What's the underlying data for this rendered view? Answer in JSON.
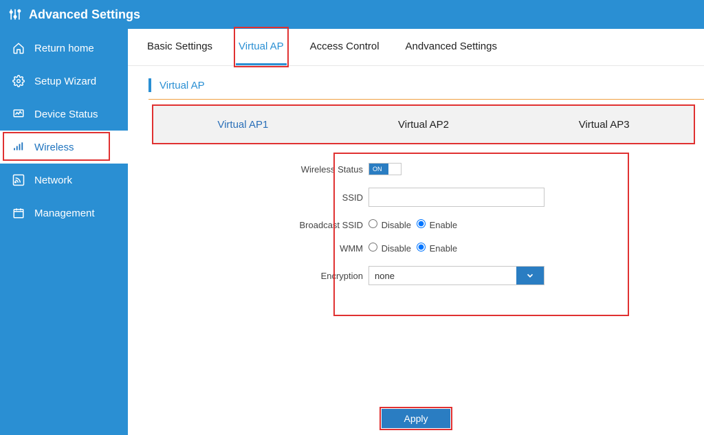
{
  "header": {
    "title": "Advanced Settings"
  },
  "sidebar": {
    "items": [
      {
        "label": "Return home"
      },
      {
        "label": "Setup Wizard"
      },
      {
        "label": "Device Status"
      },
      {
        "label": "Wireless"
      },
      {
        "label": "Network"
      },
      {
        "label": "Management"
      }
    ]
  },
  "tabs": [
    {
      "label": "Basic Settings"
    },
    {
      "label": "Virtual AP"
    },
    {
      "label": "Access Control"
    },
    {
      "label": "Andvanced Settings"
    }
  ],
  "section": {
    "title": "Virtual AP"
  },
  "subtabs": [
    {
      "label": "Virtual AP1"
    },
    {
      "label": "Virtual AP2"
    },
    {
      "label": "Virtual AP3"
    }
  ],
  "form": {
    "wireless_status": {
      "label": "Wireless Status",
      "toggle_text": "ON",
      "value": "on"
    },
    "ssid": {
      "label": "SSID",
      "value": ""
    },
    "broadcast": {
      "label": "Broadcast SSID",
      "option_disable": "Disable",
      "option_enable": "Enable",
      "value": "Enable"
    },
    "wmm": {
      "label": "WMM",
      "option_disable": "Disable",
      "option_enable": "Enable",
      "value": "Enable"
    },
    "encryption": {
      "label": "Encryption",
      "value": "none"
    }
  },
  "buttons": {
    "apply": "Apply"
  }
}
